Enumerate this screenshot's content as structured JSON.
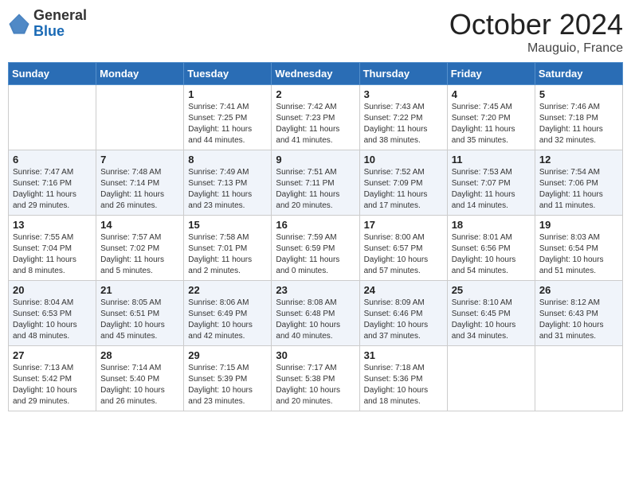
{
  "logo": {
    "general": "General",
    "blue": "Blue"
  },
  "title": {
    "month_year": "October 2024",
    "location": "Mauguio, France"
  },
  "headers": [
    "Sunday",
    "Monday",
    "Tuesday",
    "Wednesday",
    "Thursday",
    "Friday",
    "Saturday"
  ],
  "weeks": [
    [
      {
        "day": "",
        "info": ""
      },
      {
        "day": "",
        "info": ""
      },
      {
        "day": "1",
        "info": "Sunrise: 7:41 AM\nSunset: 7:25 PM\nDaylight: 11 hours\nand 44 minutes."
      },
      {
        "day": "2",
        "info": "Sunrise: 7:42 AM\nSunset: 7:23 PM\nDaylight: 11 hours\nand 41 minutes."
      },
      {
        "day": "3",
        "info": "Sunrise: 7:43 AM\nSunset: 7:22 PM\nDaylight: 11 hours\nand 38 minutes."
      },
      {
        "day": "4",
        "info": "Sunrise: 7:45 AM\nSunset: 7:20 PM\nDaylight: 11 hours\nand 35 minutes."
      },
      {
        "day": "5",
        "info": "Sunrise: 7:46 AM\nSunset: 7:18 PM\nDaylight: 11 hours\nand 32 minutes."
      }
    ],
    [
      {
        "day": "6",
        "info": "Sunrise: 7:47 AM\nSunset: 7:16 PM\nDaylight: 11 hours\nand 29 minutes."
      },
      {
        "day": "7",
        "info": "Sunrise: 7:48 AM\nSunset: 7:14 PM\nDaylight: 11 hours\nand 26 minutes."
      },
      {
        "day": "8",
        "info": "Sunrise: 7:49 AM\nSunset: 7:13 PM\nDaylight: 11 hours\nand 23 minutes."
      },
      {
        "day": "9",
        "info": "Sunrise: 7:51 AM\nSunset: 7:11 PM\nDaylight: 11 hours\nand 20 minutes."
      },
      {
        "day": "10",
        "info": "Sunrise: 7:52 AM\nSunset: 7:09 PM\nDaylight: 11 hours\nand 17 minutes."
      },
      {
        "day": "11",
        "info": "Sunrise: 7:53 AM\nSunset: 7:07 PM\nDaylight: 11 hours\nand 14 minutes."
      },
      {
        "day": "12",
        "info": "Sunrise: 7:54 AM\nSunset: 7:06 PM\nDaylight: 11 hours\nand 11 minutes."
      }
    ],
    [
      {
        "day": "13",
        "info": "Sunrise: 7:55 AM\nSunset: 7:04 PM\nDaylight: 11 hours\nand 8 minutes."
      },
      {
        "day": "14",
        "info": "Sunrise: 7:57 AM\nSunset: 7:02 PM\nDaylight: 11 hours\nand 5 minutes."
      },
      {
        "day": "15",
        "info": "Sunrise: 7:58 AM\nSunset: 7:01 PM\nDaylight: 11 hours\nand 2 minutes."
      },
      {
        "day": "16",
        "info": "Sunrise: 7:59 AM\nSunset: 6:59 PM\nDaylight: 11 hours\nand 0 minutes."
      },
      {
        "day": "17",
        "info": "Sunrise: 8:00 AM\nSunset: 6:57 PM\nDaylight: 10 hours\nand 57 minutes."
      },
      {
        "day": "18",
        "info": "Sunrise: 8:01 AM\nSunset: 6:56 PM\nDaylight: 10 hours\nand 54 minutes."
      },
      {
        "day": "19",
        "info": "Sunrise: 8:03 AM\nSunset: 6:54 PM\nDaylight: 10 hours\nand 51 minutes."
      }
    ],
    [
      {
        "day": "20",
        "info": "Sunrise: 8:04 AM\nSunset: 6:53 PM\nDaylight: 10 hours\nand 48 minutes."
      },
      {
        "day": "21",
        "info": "Sunrise: 8:05 AM\nSunset: 6:51 PM\nDaylight: 10 hours\nand 45 minutes."
      },
      {
        "day": "22",
        "info": "Sunrise: 8:06 AM\nSunset: 6:49 PM\nDaylight: 10 hours\nand 42 minutes."
      },
      {
        "day": "23",
        "info": "Sunrise: 8:08 AM\nSunset: 6:48 PM\nDaylight: 10 hours\nand 40 minutes."
      },
      {
        "day": "24",
        "info": "Sunrise: 8:09 AM\nSunset: 6:46 PM\nDaylight: 10 hours\nand 37 minutes."
      },
      {
        "day": "25",
        "info": "Sunrise: 8:10 AM\nSunset: 6:45 PM\nDaylight: 10 hours\nand 34 minutes."
      },
      {
        "day": "26",
        "info": "Sunrise: 8:12 AM\nSunset: 6:43 PM\nDaylight: 10 hours\nand 31 minutes."
      }
    ],
    [
      {
        "day": "27",
        "info": "Sunrise: 7:13 AM\nSunset: 5:42 PM\nDaylight: 10 hours\nand 29 minutes."
      },
      {
        "day": "28",
        "info": "Sunrise: 7:14 AM\nSunset: 5:40 PM\nDaylight: 10 hours\nand 26 minutes."
      },
      {
        "day": "29",
        "info": "Sunrise: 7:15 AM\nSunset: 5:39 PM\nDaylight: 10 hours\nand 23 minutes."
      },
      {
        "day": "30",
        "info": "Sunrise: 7:17 AM\nSunset: 5:38 PM\nDaylight: 10 hours\nand 20 minutes."
      },
      {
        "day": "31",
        "info": "Sunrise: 7:18 AM\nSunset: 5:36 PM\nDaylight: 10 hours\nand 18 minutes."
      },
      {
        "day": "",
        "info": ""
      },
      {
        "day": "",
        "info": ""
      }
    ]
  ]
}
